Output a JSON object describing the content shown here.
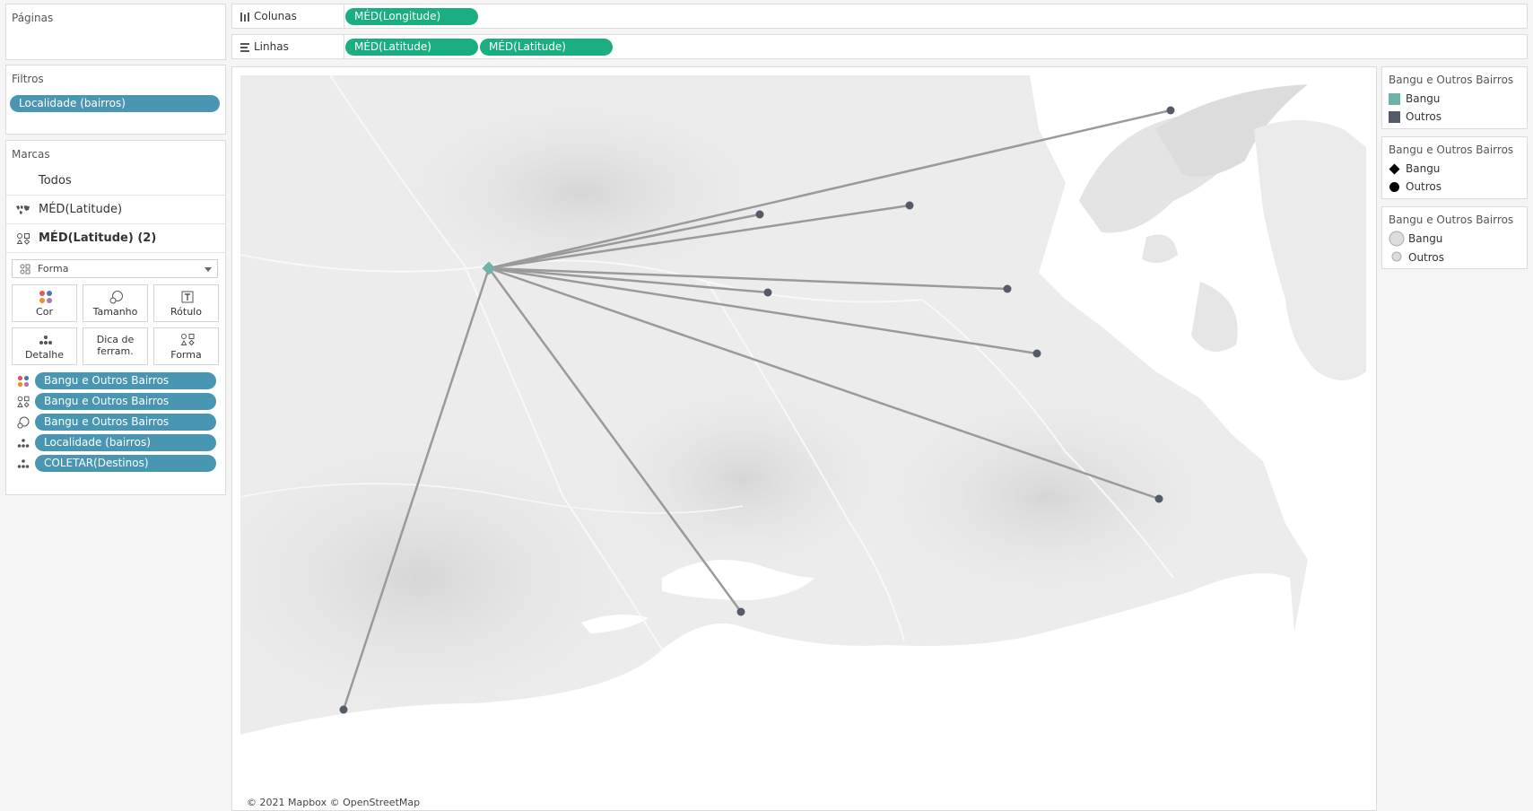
{
  "pages": {
    "title": "Páginas"
  },
  "filters": {
    "title": "Filtros",
    "pill": "Localidade (bairros)"
  },
  "marks": {
    "title": "Marcas",
    "rows": [
      {
        "label": "Todos"
      },
      {
        "label": "MÉD(Latitude)"
      },
      {
        "label": "MÉD(Latitude) (2)"
      }
    ],
    "mark_type": "Forma",
    "tiles": {
      "color": "Cor",
      "size": "Tamanho",
      "label": "Rótulo",
      "detail": "Detalhe",
      "tooltip_line1": "Dica de",
      "tooltip_line2": "ferram.",
      "shape": "Forma"
    },
    "encodings": [
      {
        "icon": "color-dots-icon",
        "field": "Bangu e Outros Bairros"
      },
      {
        "icon": "shape-icon",
        "field": "Bangu e Outros Bairros"
      },
      {
        "icon": "size-icon",
        "field": "Bangu e Outros Bairros"
      },
      {
        "icon": "detail-icon",
        "field": "Localidade (bairros)"
      },
      {
        "icon": "detail-icon",
        "field": "COLETAR(Destinos)"
      }
    ]
  },
  "shelves": {
    "columns": {
      "label": "Colunas",
      "pills": [
        "MÉD(Longitude)"
      ]
    },
    "rows": {
      "label": "Linhas",
      "pills": [
        "MÉD(Latitude)",
        "MÉD(Latitude)"
      ]
    }
  },
  "map": {
    "attribution": "© 2021 Mapbox © OpenStreetMap",
    "origin_color": "#6fb3a8",
    "destination_color": "#555b66",
    "line_color": "#9a9a9a"
  },
  "legends": {
    "color": {
      "title": "Bangu e Outros Bairros",
      "items": [
        {
          "label": "Bangu",
          "color": "#6fb3a8"
        },
        {
          "label": "Outros",
          "color": "#555b66"
        }
      ]
    },
    "shape": {
      "title": "Bangu e Outros Bairros",
      "items": [
        {
          "label": "Bangu",
          "shape": "diamond"
        },
        {
          "label": "Outros",
          "shape": "circle"
        }
      ]
    },
    "size": {
      "title": "Bangu e Outros Bairros",
      "items": [
        {
          "label": "Bangu",
          "size": "large"
        },
        {
          "label": "Outros",
          "size": "small"
        }
      ]
    }
  }
}
